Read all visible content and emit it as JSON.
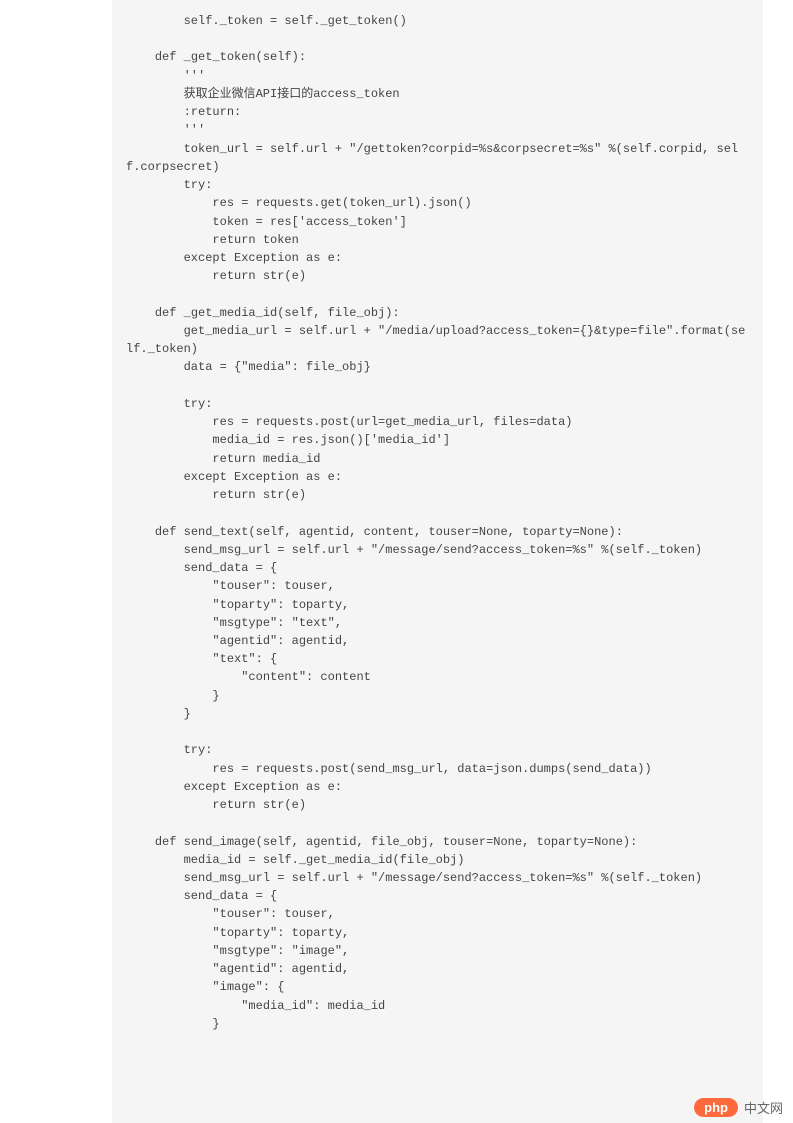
{
  "code": "        self._token = self._get_token()\n\n    def _get_token(self):\n        '''\n        获取企业微信API接口的access_token\n        :return:\n        '''\n        token_url = self.url + \"/gettoken?corpid=%s&corpsecret=%s\" %(self.corpid, self.corpsecret)\n        try:\n            res = requests.get(token_url).json()\n            token = res['access_token']\n            return token\n        except Exception as e:\n            return str(e)\n\n    def _get_media_id(self, file_obj):\n        get_media_url = self.url + \"/media/upload?access_token={}&type=file\".format(self._token)\n        data = {\"media\": file_obj}\n\n        try:\n            res = requests.post(url=get_media_url, files=data)\n            media_id = res.json()['media_id']\n            return media_id\n        except Exception as e:\n            return str(e)\n\n    def send_text(self, agentid, content, touser=None, toparty=None):\n        send_msg_url = self.url + \"/message/send?access_token=%s\" %(self._token)\n        send_data = {\n            \"touser\": touser,\n            \"toparty\": toparty,\n            \"msgtype\": \"text\",\n            \"agentid\": agentid,\n            \"text\": {\n                \"content\": content\n            }\n        }\n\n        try:\n            res = requests.post(send_msg_url, data=json.dumps(send_data))\n        except Exception as e:\n            return str(e)\n\n    def send_image(self, agentid, file_obj, touser=None, toparty=None):\n        media_id = self._get_media_id(file_obj)\n        send_msg_url = self.url + \"/message/send?access_token=%s\" %(self._token)\n        send_data = {\n            \"touser\": touser,\n            \"toparty\": toparty,\n            \"msgtype\": \"image\",\n            \"agentid\": agentid,\n            \"image\": {\n                \"media_id\": media_id\n            }",
  "watermark": {
    "badge": "php",
    "text": "中文网"
  }
}
